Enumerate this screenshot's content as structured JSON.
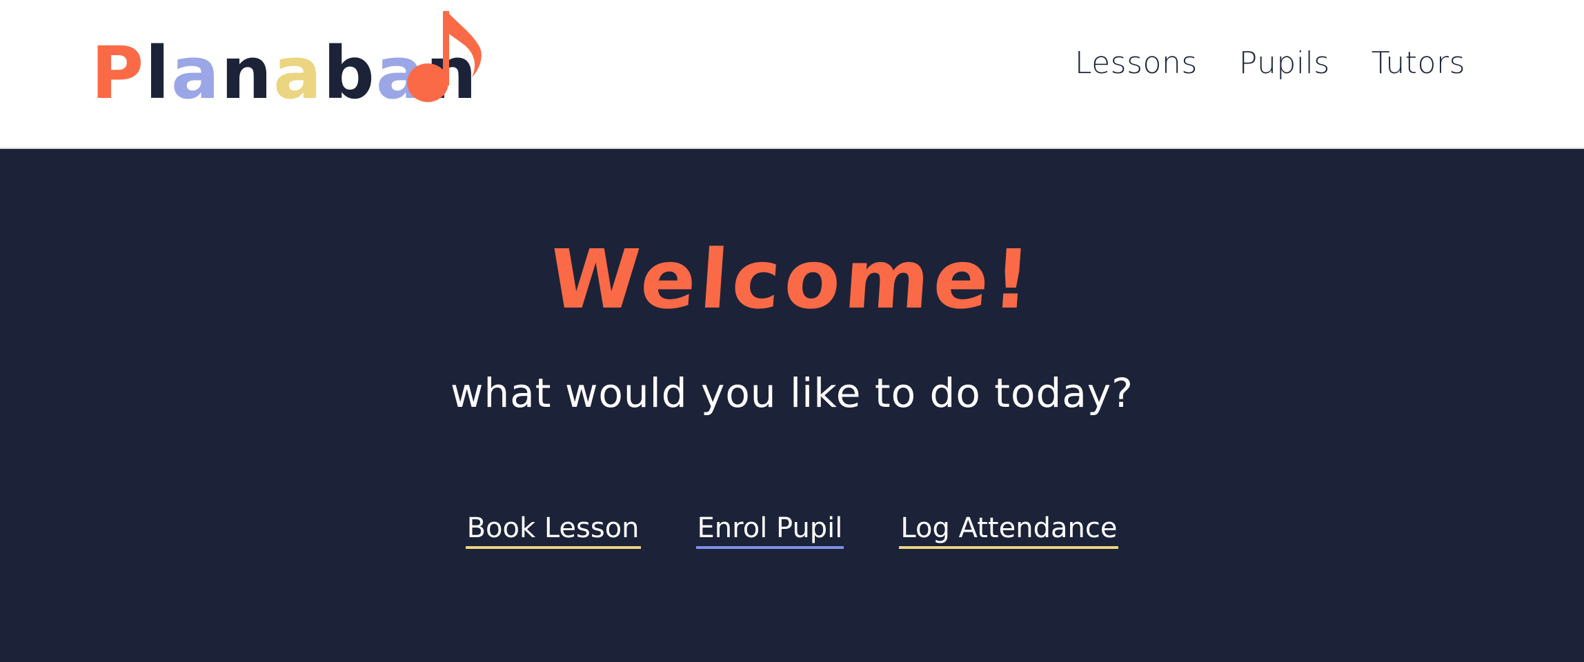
{
  "header": {
    "logo": {
      "text": "Planaband",
      "letters": [
        {
          "char": "P",
          "color": "#fb6a47"
        },
        {
          "char": "l",
          "color": "#1c2338"
        },
        {
          "char": "a",
          "color": "#9aa6e6"
        },
        {
          "char": "n",
          "color": "#1c2338"
        },
        {
          "char": "a",
          "color": "#ecd580"
        },
        {
          "char": "b",
          "color": "#1c2338"
        },
        {
          "char": "a",
          "color": "#9aa6e6"
        },
        {
          "char": "n",
          "color": "#1c2338"
        }
      ],
      "note_icon": "music-note-icon",
      "note_color": "#fb6a47"
    },
    "nav": [
      {
        "label": "Lessons"
      },
      {
        "label": "Pupils"
      },
      {
        "label": "Tutors"
      }
    ]
  },
  "hero": {
    "title": "Welcome!",
    "subtitle": "what would you like to do today?",
    "actions": [
      {
        "label": "Book Lesson",
        "underline_color": "#ecd580"
      },
      {
        "label": "Enrol Pupil",
        "underline_color": "#7f90e8"
      },
      {
        "label": "Log Attendance",
        "underline_color": "#ecd580"
      }
    ]
  },
  "colors": {
    "accent": "#fb6a47",
    "background_dark": "#1c2338",
    "header_background": "#ffffff"
  }
}
